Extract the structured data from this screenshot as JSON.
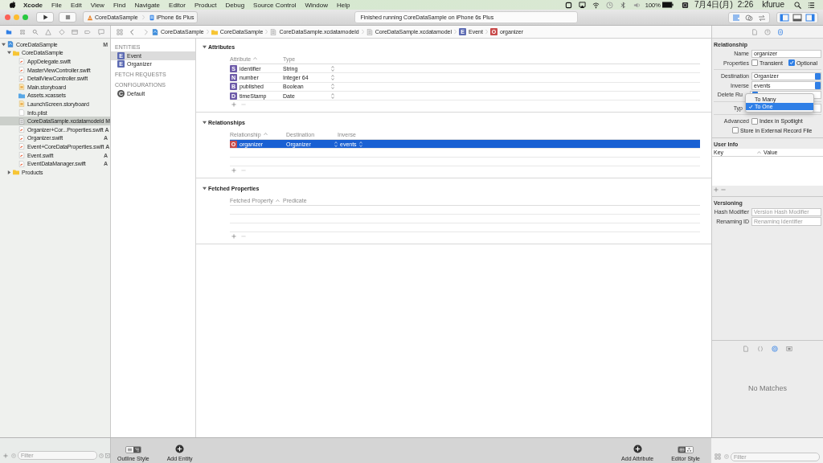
{
  "menubar": {
    "app": "Xcode",
    "menus": [
      "File",
      "Edit",
      "View",
      "Find",
      "Navigate",
      "Editor",
      "Product",
      "Debug",
      "Source Control",
      "Window",
      "Help"
    ],
    "battery": "100%",
    "date": "7月4日(月)",
    "time": "2:26",
    "user": "kfurue"
  },
  "toolbar": {
    "scheme": "CoreDataSample",
    "device": "iPhone 6s Plus",
    "activity": "Finished running CoreDataSample on iPhone 6s Plus"
  },
  "navigator_tabs": [
    {
      "kind": "folder",
      "selected": true
    },
    {
      "kind": "hierarchy",
      "selected": false
    },
    {
      "kind": "search",
      "selected": false
    },
    {
      "kind": "warning",
      "selected": false
    },
    {
      "kind": "test",
      "selected": false
    },
    {
      "kind": "debug",
      "selected": false
    },
    {
      "kind": "breakpoint",
      "selected": false
    },
    {
      "kind": "report",
      "selected": false
    }
  ],
  "jump_bar": [
    {
      "label": "CoreDataSample",
      "kind": "project"
    },
    {
      "label": "CoreDataSample",
      "kind": "folder"
    },
    {
      "label": "CoreDataSample.xcdatamodeld",
      "kind": "bundle"
    },
    {
      "label": "CoreDataSample.xcdatamodel",
      "kind": "model"
    },
    {
      "label": "Event",
      "kind": "entity",
      "badge": "E"
    },
    {
      "label": "organizer",
      "kind": "relationship",
      "badge": "O"
    }
  ],
  "navigator": {
    "tree": [
      {
        "name": "CoreDataSample",
        "kind": "project",
        "status": "M",
        "selected": false,
        "expanded": true,
        "children": [
          {
            "name": "CoreDataSample",
            "kind": "folder",
            "selected": false,
            "expanded": true,
            "children": [
              {
                "name": "AppDelegate.swift",
                "kind": "swift",
                "selected": false
              },
              {
                "name": "MasterViewController.swift",
                "kind": "swift",
                "selected": false
              },
              {
                "name": "DetailViewController.swift",
                "kind": "swift",
                "selected": false
              },
              {
                "name": "Main.storyboard",
                "kind": "storyboard",
                "selected": false
              },
              {
                "name": "Assets.xcassets",
                "kind": "assets",
                "selected": false
              },
              {
                "name": "LaunchScreen.storyboard",
                "kind": "storyboard",
                "selected": false
              },
              {
                "name": "Info.plist",
                "kind": "plist",
                "selected": false
              },
              {
                "name": "CoreDataSample.xcdatamodeld",
                "kind": "model",
                "status": "M",
                "selected": true
              },
              {
                "name": "Organizer+Cor...Properties.swift",
                "kind": "swift",
                "status": "A",
                "selected": false
              },
              {
                "name": "Organizer.swift",
                "kind": "swift",
                "status": "A",
                "selected": false
              },
              {
                "name": "Event+CoreDataProperties.swift",
                "kind": "swift",
                "status": "A",
                "selected": false
              },
              {
                "name": "Event.swift",
                "kind": "swift",
                "status": "A",
                "selected": false
              },
              {
                "name": "EventDataManager.swift",
                "kind": "swift",
                "status": "A",
                "selected": false
              }
            ]
          },
          {
            "name": "Products",
            "kind": "folder",
            "selected": false,
            "expanded": false
          }
        ]
      }
    ],
    "filter": {
      "placeholder": "Filter"
    }
  },
  "outline": {
    "sections": [
      {
        "title": "ENTITIES",
        "items": [
          {
            "badge": "E",
            "name": "Event",
            "kind": "entity",
            "selected": true
          },
          {
            "badge": "E",
            "name": "Organizer",
            "kind": "entity",
            "selected": false
          }
        ]
      },
      {
        "title": "FETCH REQUESTS"
      },
      {
        "title": "CONFIGURATIONS",
        "items": [
          {
            "badge": "C",
            "name": "Default",
            "kind": "configuration",
            "selected": false
          }
        ]
      }
    ]
  },
  "editor": {
    "sections": [
      {
        "kind": "attributes",
        "title": "Attributes",
        "columns": [
          "Attribute",
          "Type"
        ],
        "rows": [
          {
            "badge": "S",
            "cells": [
              "identifier",
              "String"
            ],
            "selected": false
          },
          {
            "badge": "N",
            "cells": [
              "number",
              "Integer 64"
            ],
            "selected": false
          },
          {
            "badge": "B",
            "cells": [
              "published",
              "Boolean"
            ],
            "selected": false
          },
          {
            "badge": "D",
            "cells": [
              "timeStamp",
              "Date"
            ],
            "selected": false
          }
        ]
      },
      {
        "kind": "relationships",
        "title": "Relationships",
        "columns": [
          "Relationship",
          "Destination",
          "Inverse"
        ],
        "rows": [
          {
            "badge": "O",
            "cells": [
              "organizer",
              "Organizer",
              "events"
            ],
            "selected": true
          }
        ]
      },
      {
        "kind": "fetched",
        "title": "Fetched Properties",
        "columns": [
          "Fetched Property",
          "Predicate"
        ]
      }
    ]
  },
  "inspector": {
    "tabs": [
      {
        "kind": "file",
        "selected": false
      },
      {
        "kind": "help",
        "selected": false
      },
      {
        "kind": "model",
        "selected": true
      }
    ],
    "title": "Relationship",
    "name_label": "Name",
    "name": "organizer",
    "properties_label": "Properties",
    "properties": [
      {
        "label": "Transient",
        "checked": false
      },
      {
        "label": "Optional",
        "checked": true
      }
    ],
    "destination_label": "Destination",
    "destination": "Organizer",
    "inverse_label": "Inverse",
    "inverse": "events",
    "delete_rule_label": "Delete Ru",
    "type_label": "Typ",
    "type_menu": [
      {
        "label": "To Many",
        "selected": false
      },
      {
        "label": "To One",
        "selected": true
      }
    ],
    "advanced_label": "Advanced",
    "advanced": [
      {
        "label": "Index in Spotlight",
        "checked": false
      },
      {
        "label": "Store in External Record File",
        "checked": false
      }
    ],
    "user_info_title": "User Info",
    "user_info_columns": [
      "Key",
      "Value"
    ],
    "versioning_title": "Versioning",
    "hash_label": "Hash Modifier",
    "hash_placeholder": "Version Hash Modifier",
    "renaming_label": "Renaming ID",
    "renaming_placeholder": "Renaming Identifier"
  },
  "library": {
    "tabs": [
      {
        "kind": "file",
        "selected": false
      },
      {
        "kind": "braces",
        "selected": false
      },
      {
        "kind": "object",
        "selected": true
      },
      {
        "kind": "media",
        "selected": false
      }
    ],
    "empty": "No Matches",
    "filter": {
      "placeholder": "Filter"
    }
  },
  "bottom_bar": {
    "outline_style": {
      "label": "Outline Style",
      "segments": [
        {
          "kind": "list",
          "selected": false
        },
        {
          "kind": "tree",
          "selected": true
        }
      ]
    },
    "add_entity": "Add Entity",
    "add_attribute": "Add Attribute",
    "editor_style": {
      "label": "Editor Style",
      "segments": [
        {
          "kind": "table",
          "selected": true
        },
        {
          "kind": "graph",
          "selected": false
        }
      ]
    }
  }
}
